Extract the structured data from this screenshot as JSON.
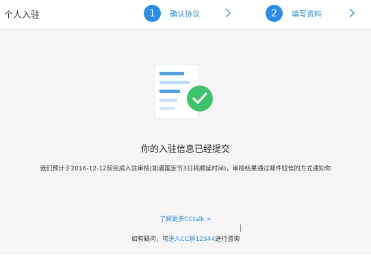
{
  "header": {
    "title": "个人入驻",
    "steps": [
      {
        "number": "1",
        "label": "确认协议"
      },
      {
        "number": "2",
        "label": "填写资料"
      }
    ]
  },
  "main": {
    "icon": "document-check-icon",
    "title": "你的入驻信息已经提交",
    "description": "我们预计于2016-12-12前完成入驻审核(如遇国定节3日将顺延时间)，审核结果通过邮件短信的方式通知你",
    "learn_more": "了解更多CCtalk >",
    "help_prefix": "如有疑问，可",
    "help_link": "进入CC群12344",
    "help_suffix": "进行咨询"
  },
  "colors": {
    "accent": "#2a8ee8",
    "success": "#3cc36b",
    "background": "#f5f5f5"
  }
}
